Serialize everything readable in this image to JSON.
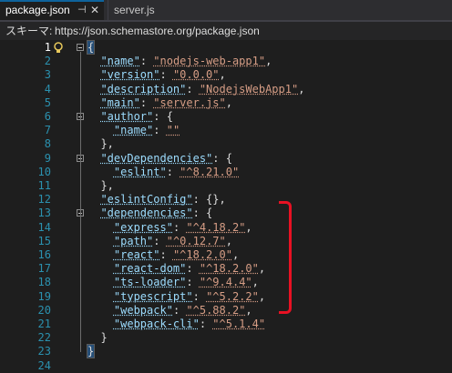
{
  "tabs": [
    {
      "label": "package.json",
      "active": true,
      "pin_icon": "pin-icon",
      "close_icon": "close-icon"
    },
    {
      "label": "server.js",
      "active": false
    }
  ],
  "schema": {
    "label": "スキーマ:",
    "url": "https://json.schemastore.org/package.json"
  },
  "lines": [
    {
      "num": "1",
      "tokens": [
        {
          "t": "{",
          "c": "brace"
        }
      ]
    },
    {
      "num": "2",
      "tokens": [
        {
          "t": "  ",
          "c": "p"
        },
        {
          "t": "\"name\"",
          "c": "key"
        },
        {
          "t": ": ",
          "c": "p"
        },
        {
          "t": "\"nodejs-web-app1\"",
          "c": "str"
        },
        {
          "t": ",",
          "c": "p"
        }
      ]
    },
    {
      "num": "3",
      "tokens": [
        {
          "t": "  ",
          "c": "p"
        },
        {
          "t": "\"version\"",
          "c": "key"
        },
        {
          "t": ": ",
          "c": "p"
        },
        {
          "t": "\"0.0.0\"",
          "c": "str"
        },
        {
          "t": ",",
          "c": "p"
        }
      ]
    },
    {
      "num": "4",
      "tokens": [
        {
          "t": "  ",
          "c": "p"
        },
        {
          "t": "\"description\"",
          "c": "key"
        },
        {
          "t": ": ",
          "c": "p"
        },
        {
          "t": "\"NodejsWebApp1\"",
          "c": "str"
        },
        {
          "t": ",",
          "c": "p"
        }
      ]
    },
    {
      "num": "5",
      "tokens": [
        {
          "t": "  ",
          "c": "p"
        },
        {
          "t": "\"main\"",
          "c": "key"
        },
        {
          "t": ": ",
          "c": "p"
        },
        {
          "t": "\"server.js\"",
          "c": "str"
        },
        {
          "t": ",",
          "c": "p"
        }
      ]
    },
    {
      "num": "6",
      "tokens": [
        {
          "t": "  ",
          "c": "p"
        },
        {
          "t": "\"author\"",
          "c": "key"
        },
        {
          "t": ": {",
          "c": "p"
        }
      ]
    },
    {
      "num": "7",
      "tokens": [
        {
          "t": "    ",
          "c": "p"
        },
        {
          "t": "\"name\"",
          "c": "key"
        },
        {
          "t": ": ",
          "c": "p"
        },
        {
          "t": "\"\"",
          "c": "str"
        }
      ]
    },
    {
      "num": "8",
      "tokens": [
        {
          "t": "  },",
          "c": "p"
        }
      ]
    },
    {
      "num": "9",
      "tokens": [
        {
          "t": "  ",
          "c": "p"
        },
        {
          "t": "\"devDependencies\"",
          "c": "key"
        },
        {
          "t": ": {",
          "c": "p"
        }
      ]
    },
    {
      "num": "10",
      "tokens": [
        {
          "t": "    ",
          "c": "p"
        },
        {
          "t": "\"eslint\"",
          "c": "key"
        },
        {
          "t": ": ",
          "c": "p"
        },
        {
          "t": "\"^8.21.0\"",
          "c": "str"
        }
      ]
    },
    {
      "num": "11",
      "tokens": [
        {
          "t": "  },",
          "c": "p"
        }
      ]
    },
    {
      "num": "12",
      "tokens": [
        {
          "t": "  ",
          "c": "p"
        },
        {
          "t": "\"eslintConfig\"",
          "c": "key"
        },
        {
          "t": ": {},",
          "c": "p"
        }
      ]
    },
    {
      "num": "13",
      "tokens": [
        {
          "t": "  ",
          "c": "p"
        },
        {
          "t": "\"dependencies\"",
          "c": "key"
        },
        {
          "t": ": {",
          "c": "p"
        }
      ]
    },
    {
      "num": "14",
      "tokens": [
        {
          "t": "    ",
          "c": "p"
        },
        {
          "t": "\"express\"",
          "c": "key"
        },
        {
          "t": ": ",
          "c": "p"
        },
        {
          "t": "\"^4.18.2\"",
          "c": "str"
        },
        {
          "t": ",",
          "c": "p"
        }
      ]
    },
    {
      "num": "15",
      "tokens": [
        {
          "t": "    ",
          "c": "p"
        },
        {
          "t": "\"path\"",
          "c": "key"
        },
        {
          "t": ": ",
          "c": "p"
        },
        {
          "t": "\"^0.12.7\"",
          "c": "str"
        },
        {
          "t": ",",
          "c": "p"
        }
      ]
    },
    {
      "num": "16",
      "tokens": [
        {
          "t": "    ",
          "c": "p"
        },
        {
          "t": "\"react\"",
          "c": "key"
        },
        {
          "t": ": ",
          "c": "p"
        },
        {
          "t": "\"^18.2.0\"",
          "c": "str"
        },
        {
          "t": ",",
          "c": "p"
        }
      ]
    },
    {
      "num": "17",
      "tokens": [
        {
          "t": "    ",
          "c": "p"
        },
        {
          "t": "\"react-dom\"",
          "c": "key"
        },
        {
          "t": ": ",
          "c": "p"
        },
        {
          "t": "\"^18.2.0\"",
          "c": "str"
        },
        {
          "t": ",",
          "c": "p"
        }
      ]
    },
    {
      "num": "18",
      "tokens": [
        {
          "t": "    ",
          "c": "p"
        },
        {
          "t": "\"ts-loader\"",
          "c": "key"
        },
        {
          "t": ": ",
          "c": "p"
        },
        {
          "t": "\"^9.4.4\"",
          "c": "str"
        },
        {
          "t": ",",
          "c": "p"
        }
      ]
    },
    {
      "num": "19",
      "tokens": [
        {
          "t": "    ",
          "c": "p"
        },
        {
          "t": "\"typescript\"",
          "c": "key"
        },
        {
          "t": ": ",
          "c": "p"
        },
        {
          "t": "\"^5.2.2\"",
          "c": "str"
        },
        {
          "t": ",",
          "c": "p"
        }
      ]
    },
    {
      "num": "20",
      "tokens": [
        {
          "t": "    ",
          "c": "p"
        },
        {
          "t": "\"webpack\"",
          "c": "key"
        },
        {
          "t": ": ",
          "c": "p"
        },
        {
          "t": "\"^5.88.2\"",
          "c": "str"
        },
        {
          "t": ",",
          "c": "p"
        }
      ]
    },
    {
      "num": "21",
      "tokens": [
        {
          "t": "    ",
          "c": "p"
        },
        {
          "t": "\"webpack-cli\"",
          "c": "key"
        },
        {
          "t": ": ",
          "c": "p"
        },
        {
          "t": "\"^5.1.4\"",
          "c": "str"
        }
      ]
    },
    {
      "num": "22",
      "tokens": [
        {
          "t": "  }",
          "c": "p"
        }
      ]
    },
    {
      "num": "23",
      "tokens": [
        {
          "t": "}",
          "c": "brace"
        }
      ]
    },
    {
      "num": "24",
      "tokens": []
    }
  ],
  "fold_lines": [
    1,
    6,
    9,
    13
  ],
  "colors": {
    "key": "#9cdcfe",
    "string": "#d69d85",
    "line_number": "#2b91af",
    "annotation": "#e81123",
    "background": "#1e1e1e"
  }
}
